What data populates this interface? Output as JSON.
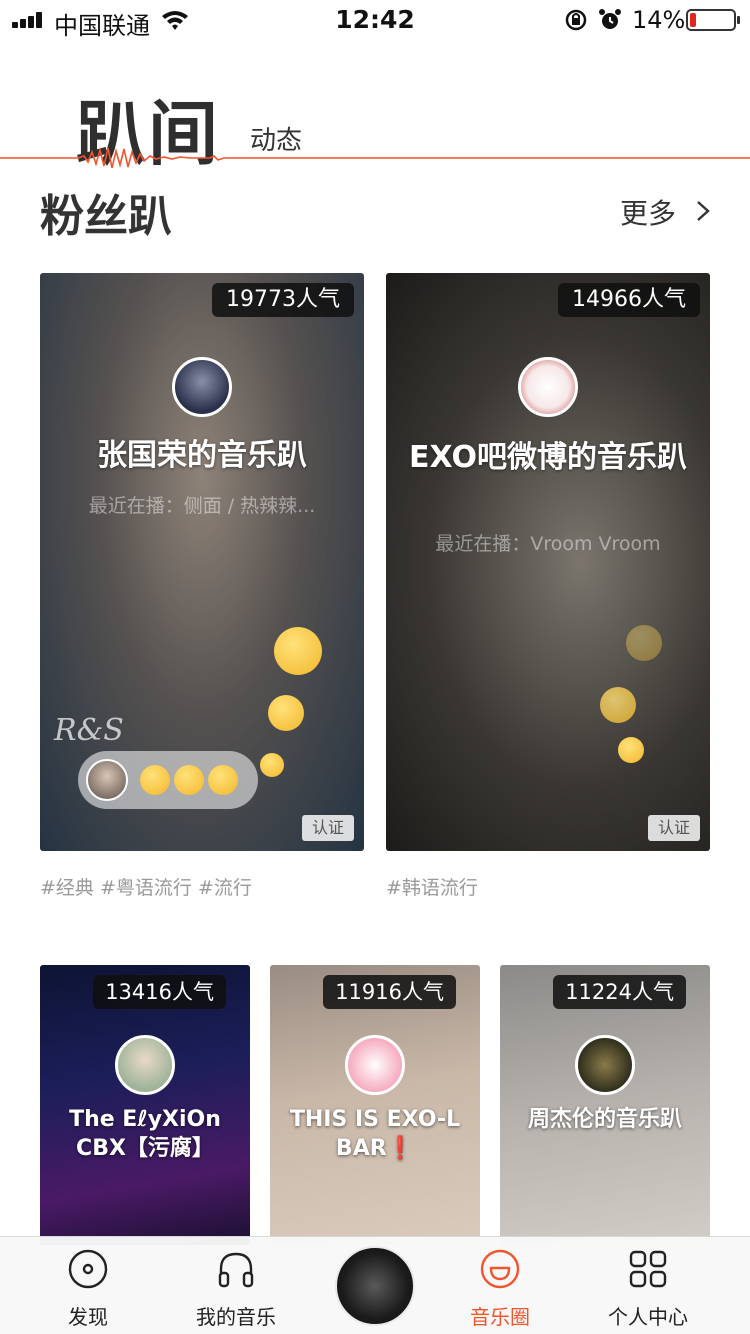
{
  "status_bar": {
    "carrier": "中国联通",
    "time": "12:42",
    "battery_percent_label": "14%",
    "battery_level": 0.14,
    "battery_color": "#e2281c"
  },
  "header": {
    "title": "趴间",
    "subtitle": "动态",
    "accent_color": "#f2542d"
  },
  "section": {
    "title": "粉丝趴",
    "more_label": "更多"
  },
  "featured": [
    {
      "popularity": "19773人气",
      "name": "张国荣的音乐趴",
      "now_playing": "最近在播：侧面 / 热辣辣...",
      "cert": "认证",
      "tags": "#经典 #粤语流行 #流行",
      "watermark": "R&S"
    },
    {
      "popularity": "14966人气",
      "name": "EXO吧微博的音乐趴",
      "now_playing": "最近在播：Vroom Vroom",
      "cert": "认证",
      "tags": "#韩语流行"
    }
  ],
  "rooms": [
    {
      "popularity": "13416人气",
      "name": "The EℓyXiOn CBX【污腐】"
    },
    {
      "popularity": "11916人气",
      "name": "THIS IS EXO-L BAR❗"
    },
    {
      "popularity": "11224人气",
      "name": "周杰伦的音乐趴"
    }
  ],
  "tabbar": {
    "items": [
      {
        "label": "发现",
        "icon": "disc-icon"
      },
      {
        "label": "我的音乐",
        "icon": "headphones-icon"
      },
      {
        "label": "音乐圈",
        "icon": "smile-circle-icon",
        "active": true
      },
      {
        "label": "个人中心",
        "icon": "grid-icon"
      }
    ],
    "active_color": "#f2542d"
  }
}
